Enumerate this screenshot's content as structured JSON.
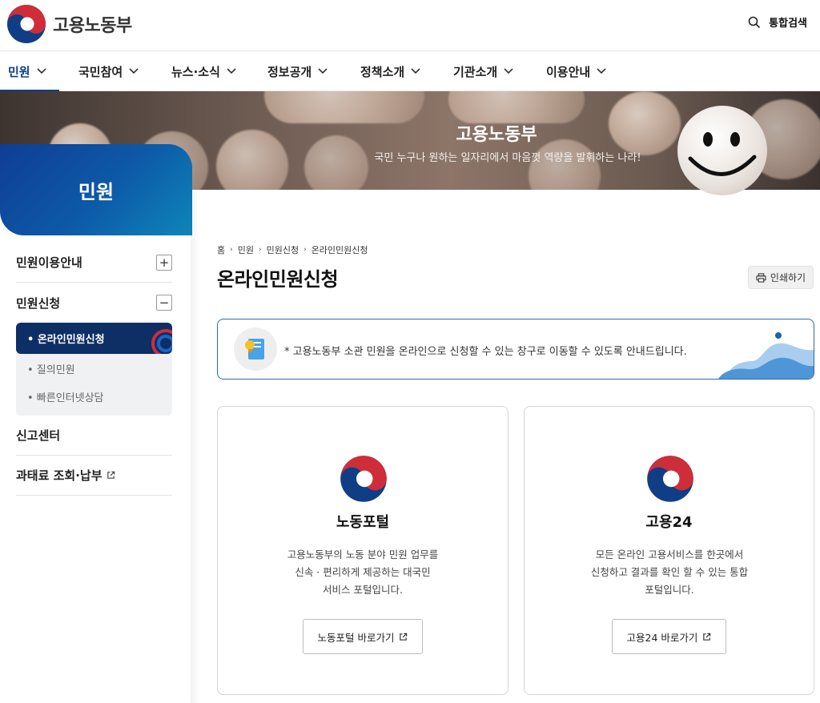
{
  "header": {
    "logo_text": "고용노동부",
    "search_label": "통합검색"
  },
  "gnb": [
    {
      "label": "민원",
      "active": true
    },
    {
      "label": "국민참여"
    },
    {
      "label": "뉴스·소식"
    },
    {
      "label": "정보공개"
    },
    {
      "label": "정책소개"
    },
    {
      "label": "기관소개"
    },
    {
      "label": "이용안내"
    }
  ],
  "banner": {
    "title": "고용노동부",
    "subtitle": "국민 누구나 원하는 일자리에서 마음껏 역량을 발휘하는 나라!"
  },
  "sidebar": {
    "title": "민원",
    "items": [
      {
        "label": "민원이용안내",
        "toggle": "+"
      },
      {
        "label": "민원신청",
        "toggle": "−"
      },
      {
        "label": "신고센터"
      },
      {
        "label": "과태료 조회·납부"
      }
    ],
    "sub_items": [
      {
        "label": "• 온라인민원신청",
        "active": true
      },
      {
        "label": "• 질의민원"
      },
      {
        "label": "• 빠른인터넷상담"
      }
    ]
  },
  "breadcrumb": [
    "홈",
    "민원",
    "민원신청",
    "온라인민원신청"
  ],
  "page_title": "온라인민원신청",
  "print_label": "인쇄하기",
  "notice": "* 고용노동부 소관 민원을 온라인으로 신청할 수 있는 창구로 이동할 수 있도록 안내드립니다.",
  "cards": [
    {
      "title": "노동포털",
      "desc": [
        "고용노동부의 노동 분야 민원 업무를",
        "신속 · 편리하게 제공하는 대국민",
        "서비스 포털입니다."
      ],
      "button": "노동포털 바로가기"
    },
    {
      "title": "고용24",
      "desc": [
        "모든 온라인 고용서비스를 한곳에서",
        "신청하고 결과를 확인 할 수 있는 통합",
        "포털입니다."
      ],
      "button": "고용24 바로가기"
    }
  ],
  "colors": {
    "brand_navy": "#0b3f8c",
    "emblem_red": "#cd2e3a",
    "emblem_blue": "#0f3e86",
    "notice_border": "#2f69a9"
  },
  "icons": {
    "search": "search-icon",
    "chevron": "chevron-down-icon",
    "print": "printer-icon",
    "external": "external-link-icon",
    "notice": "lightbulb-document-icon",
    "emblem": "taegeuk-emblem-icon"
  }
}
